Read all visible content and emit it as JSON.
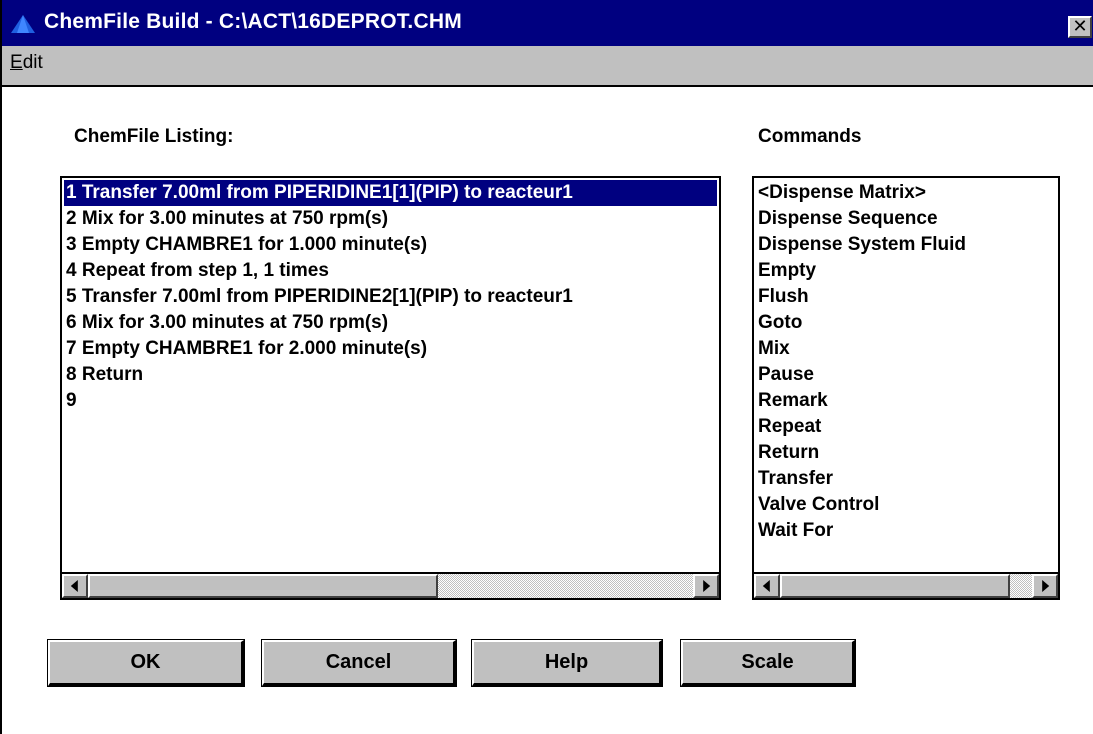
{
  "window": {
    "title": "ChemFile Build - C:\\ACT\\16DEPROT.CHM",
    "close_label": "✕",
    "accent_color": "#000080",
    "face_color": "#c0c0c0"
  },
  "menu": {
    "edit_underlined": "E",
    "edit_rest": "dit"
  },
  "chemfile": {
    "label": "ChemFile Listing:",
    "items": [
      "1 Transfer 7.00ml from PIPERIDINE1[1](PIP) to reacteur1",
      "2 Mix for 3.00 minutes  at 750 rpm(s)",
      "3 Empty CHAMBRE1 for 1.000 minute(s)",
      "4 Repeat from step 1, 1 times",
      "5 Transfer 7.00ml from PIPERIDINE2[1](PIP) to reacteur1",
      "6 Mix for 3.00 minutes  at 750 rpm(s)",
      "7 Empty CHAMBRE1 for 2.000 minute(s)",
      "8 Return",
      "9"
    ],
    "selected_index": 0
  },
  "commands": {
    "label": "Commands",
    "items": [
      "<Dispense Matrix>",
      "Dispense Sequence",
      "Dispense System Fluid",
      "Empty",
      "Flush",
      "Goto",
      "Mix",
      "Pause",
      "Remark",
      "Repeat",
      "Return",
      "Transfer",
      "Valve Control",
      "Wait For"
    ]
  },
  "buttons": {
    "ok": "OK",
    "cancel": "Cancel",
    "help": "Help",
    "scale": "Scale"
  }
}
